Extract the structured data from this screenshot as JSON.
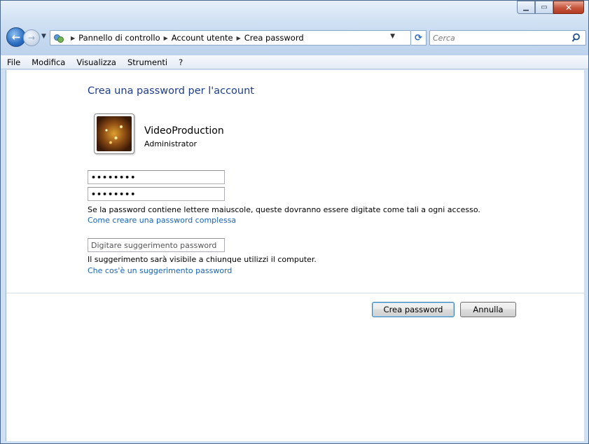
{
  "window": {
    "caption_buttons": {
      "minimize_icon": "minimize-icon",
      "maximize_icon": "maximize-icon",
      "close_icon": "close-icon"
    }
  },
  "nav": {
    "back_icon": "back-arrow-icon",
    "forward_icon": "forward-arrow-icon",
    "breadcrumbs": [
      "Pannello di controllo",
      "Account utente",
      "Crea password"
    ],
    "search_placeholder": "Cerca"
  },
  "menu": {
    "items": [
      "File",
      "Modifica",
      "Visualizza",
      "Strumenti",
      "?"
    ]
  },
  "main": {
    "title": "Crea una password per l'account",
    "user": {
      "name": "VideoProduction",
      "role": "Administrator"
    },
    "password_mask": "••••••••",
    "confirm_mask": "••••••••",
    "case_note": "Se la password contiene lettere maiuscole, queste dovranno essere digitate come tali a ogni accesso.",
    "strong_password_link": "Come creare una password complessa",
    "hint_placeholder": "Digitare suggerimento password",
    "hint_note": "Il suggerimento sarà visibile a chiunque utilizzi il computer.",
    "hint_link": "Che cos'è un suggerimento password"
  },
  "buttons": {
    "create": "Crea password",
    "cancel": "Annulla"
  },
  "colors": {
    "title": "#1e3d8a",
    "link": "#1465bb",
    "frame": "#cfe0f3"
  }
}
